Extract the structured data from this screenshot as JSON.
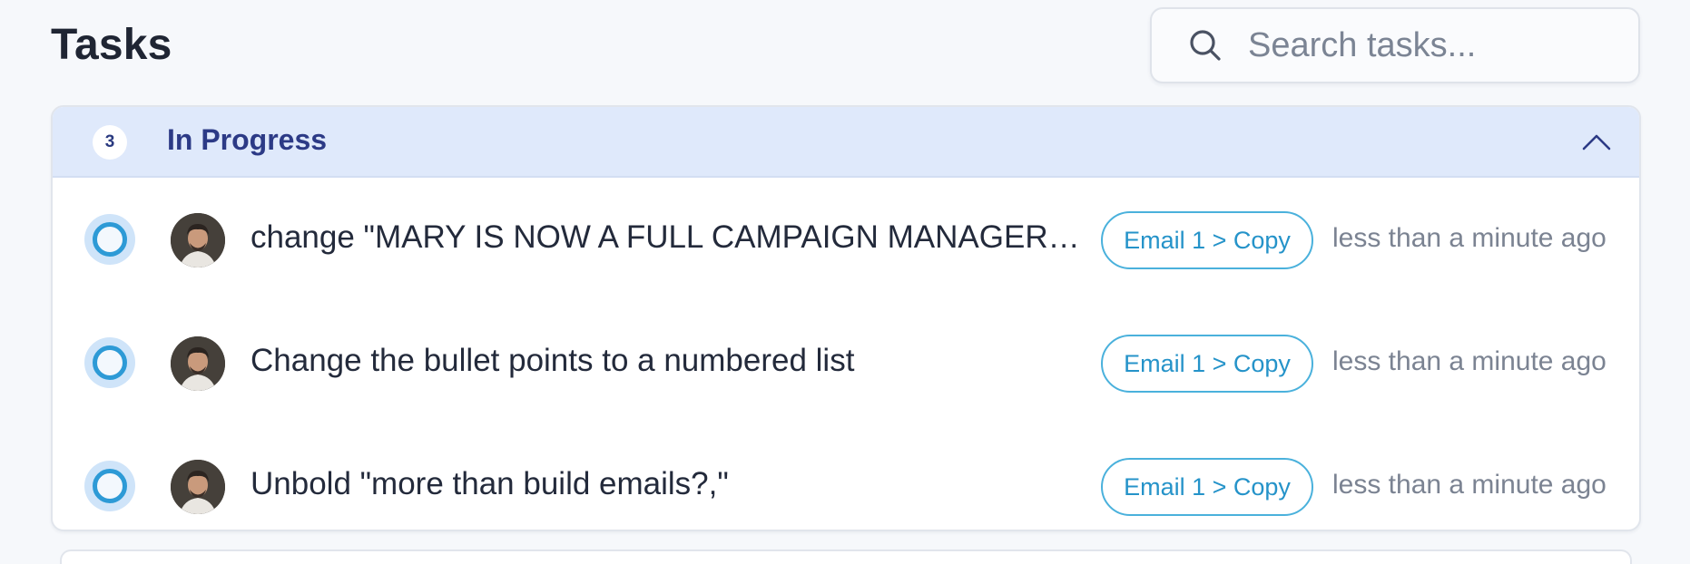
{
  "page": {
    "title": "Tasks"
  },
  "search": {
    "placeholder": "Search tasks...",
    "value": "",
    "icon": "search-icon"
  },
  "group": {
    "count": "3",
    "title": "In Progress",
    "collapse_icon": "chevron-up-icon",
    "header_color": "#dfe9fb",
    "accent_color": "#2c3a86"
  },
  "tasks": [
    {
      "text": "change \"MARY IS NOW A FULL CAMPAIGN MANAGER…",
      "tag": "Email 1 > Copy",
      "time": "less than a minute ago",
      "status_icon": "in-progress-circle-icon"
    },
    {
      "text": "Change the bullet points to a numbered list",
      "tag": "Email 1 > Copy",
      "time": "less than a minute ago",
      "status_icon": "in-progress-circle-icon"
    },
    {
      "text": "Unbold \"more than build emails?,\"",
      "tag": "Email 1 > Copy",
      "time": "less than a minute ago",
      "status_icon": "in-progress-circle-icon"
    }
  ],
  "colors": {
    "status_ring": "#2d9ad6",
    "tag_border": "#4ab1dc",
    "tag_text": "#2593c9"
  }
}
